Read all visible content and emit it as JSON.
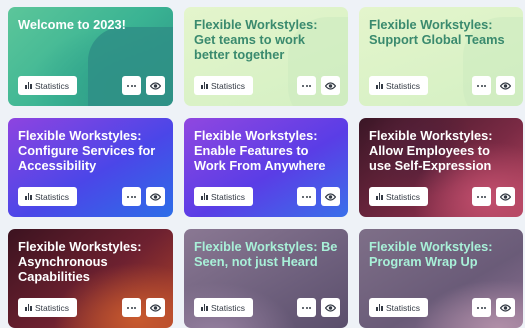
{
  "cards": [
    {
      "title": "Welcome to 2023!",
      "stats_label": "Statistics"
    },
    {
      "title": "Flexible Workstyles: Get teams to work better together",
      "stats_label": "Statistics"
    },
    {
      "title": "Flexible Workstyles: Support Global Teams",
      "stats_label": "Statistics"
    },
    {
      "title": "Flexible Workstyles: Configure Services for Accessibility",
      "stats_label": "Statistics"
    },
    {
      "title": "Flexible Workstyles: Enable Features to Work From Anywhere",
      "stats_label": "Statistics"
    },
    {
      "title": "Flexible Workstyles: Allow Employees to use Self-Expression",
      "stats_label": "Statistics"
    },
    {
      "title": "Flexible Workstyles: Asynchronous Capabilities",
      "stats_label": "Statistics"
    },
    {
      "title": "Flexible Workstyles: Be Seen, not just Heard",
      "stats_label": "Statistics"
    },
    {
      "title": "Flexible Workstyles: Program Wrap Up",
      "stats_label": "Statistics"
    }
  ],
  "icons": {
    "stats": "bar-chart-icon",
    "more": "more-horizontal-icon",
    "view": "eye-icon"
  },
  "colors": {
    "page_background": "#eef2f7",
    "button_background": "#ffffff",
    "title_green": "#3a8a6e",
    "title_mint": "#a8f0d8"
  }
}
